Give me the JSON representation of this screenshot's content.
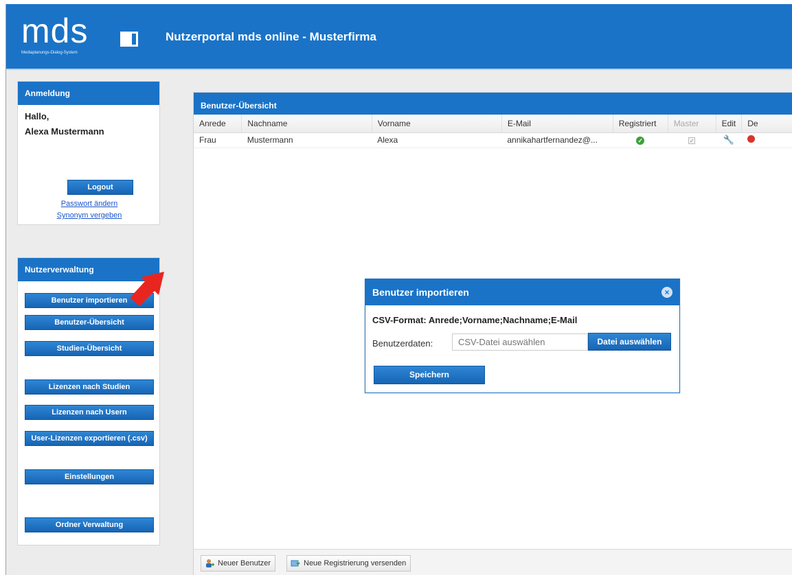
{
  "header": {
    "logo_text": "mds",
    "logo_subtitle": "Mediaplanungs-Dialog-System",
    "title": "Nutzerportal mds online - Musterfirma"
  },
  "login": {
    "heading": "Anmeldung",
    "greeting": "Hallo,",
    "user_name": "Alexa Mustermann",
    "logout_label": "Logout",
    "change_password_link": "Passwort ändern",
    "synonym_link": "Synonym vergeben"
  },
  "management": {
    "heading": "Nutzerverwaltung",
    "buttons": [
      "Benutzer importieren",
      "Benutzer-Übersicht",
      "Studien-Übersicht",
      "Lizenzen nach Studien",
      "Lizenzen nach Usern",
      "User-Lizenzen exportieren (.csv)",
      "Einstellungen",
      "Ordner Verwaltung"
    ]
  },
  "overview": {
    "heading": "Benutzer-Übersicht",
    "columns": [
      "Anrede",
      "Nachname",
      "Vorname",
      "E-Mail",
      "Registriert",
      "Master",
      "Edit",
      "De"
    ],
    "rows": [
      {
        "anrede": "Frau",
        "nachname": "Mustermann",
        "vorname": "Alexa",
        "email": "annikahartfernandez@...",
        "registriert": true,
        "master": true
      }
    ],
    "footer": {
      "new_user_label": "Neuer Benutzer",
      "new_registration_label": "Neue Registrierung versenden"
    }
  },
  "dialog": {
    "title": "Benutzer importieren",
    "format_text": "CSV-Format: Anrede;Vorname;Nachname;E-Mail",
    "field_label": "Benutzerdaten:",
    "file_placeholder": "CSV-Datei auswählen",
    "choose_file_label": "Datei auswählen",
    "save_label": "Speichern"
  },
  "colors": {
    "brand_blue": "#1a73c7",
    "highlight_arrow": "#e8261f",
    "success_green": "#3aa23a",
    "delete_red": "#d9342b"
  }
}
